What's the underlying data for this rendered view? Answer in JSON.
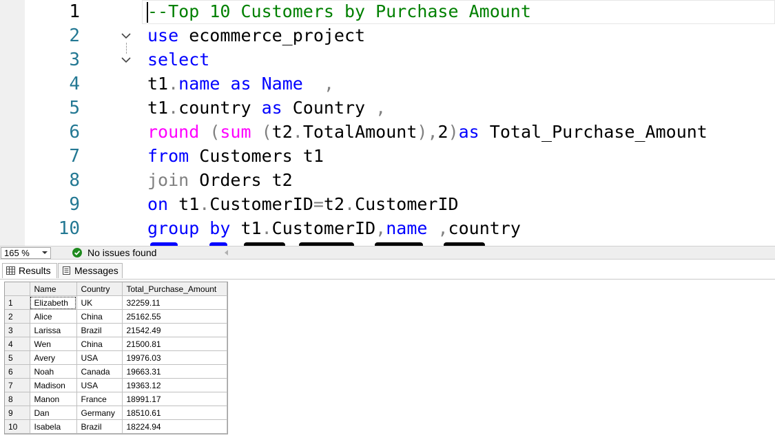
{
  "editor": {
    "active_line": 1,
    "line_numbers": [
      "1",
      "2",
      "3",
      "4",
      "5",
      "6",
      "7",
      "8",
      "9",
      "10"
    ],
    "code_lines": [
      [
        {
          "t": "--Top 10 Customers by Purchase Amount",
          "c": "com"
        }
      ],
      [
        {
          "t": "use",
          "c": "kw"
        },
        {
          "t": " ecommerce_project",
          "c": "id"
        }
      ],
      [
        {
          "t": "select",
          "c": "kw"
        }
      ],
      [
        {
          "t": "t1",
          "c": "id"
        },
        {
          "t": ".",
          "c": "gray"
        },
        {
          "t": "name",
          "c": "kw"
        },
        {
          "t": " ",
          "c": "id"
        },
        {
          "t": "as",
          "c": "kw"
        },
        {
          "t": " ",
          "c": "id"
        },
        {
          "t": "Name",
          "c": "kw"
        },
        {
          "t": "  ,",
          "c": "gray"
        }
      ],
      [
        {
          "t": "t1",
          "c": "id"
        },
        {
          "t": ".",
          "c": "gray"
        },
        {
          "t": "country ",
          "c": "id"
        },
        {
          "t": "as",
          "c": "kw"
        },
        {
          "t": " Country ",
          "c": "id"
        },
        {
          "t": ",",
          "c": "gray"
        }
      ],
      [
        {
          "t": "round",
          "c": "fn"
        },
        {
          "t": " (",
          "c": "gray"
        },
        {
          "t": "sum",
          "c": "fn"
        },
        {
          "t": " (",
          "c": "gray"
        },
        {
          "t": "t2",
          "c": "id"
        },
        {
          "t": ".",
          "c": "gray"
        },
        {
          "t": "TotalAmount",
          "c": "id"
        },
        {
          "t": "),",
          "c": "gray"
        },
        {
          "t": "2",
          "c": "id"
        },
        {
          "t": ")",
          "c": "gray"
        },
        {
          "t": "as",
          "c": "kw"
        },
        {
          "t": " Total_Purchase_Amount",
          "c": "id"
        }
      ],
      [
        {
          "t": "from",
          "c": "kw"
        },
        {
          "t": " Customers t1",
          "c": "id"
        }
      ],
      [
        {
          "t": "join",
          "c": "gray"
        },
        {
          "t": " Orders t2",
          "c": "id"
        }
      ],
      [
        {
          "t": "on",
          "c": "kw"
        },
        {
          "t": " t1",
          "c": "id"
        },
        {
          "t": ".",
          "c": "gray"
        },
        {
          "t": "CustomerID",
          "c": "id"
        },
        {
          "t": "=",
          "c": "gray"
        },
        {
          "t": "t2",
          "c": "id"
        },
        {
          "t": ".",
          "c": "gray"
        },
        {
          "t": "CustomerID",
          "c": "id"
        }
      ],
      [
        {
          "t": "group by",
          "c": "kw"
        },
        {
          "t": " t1",
          "c": "id"
        },
        {
          "t": ".",
          "c": "gray"
        },
        {
          "t": "CustomerID",
          "c": "id"
        },
        {
          "t": ",",
          "c": "gray"
        },
        {
          "t": "name",
          "c": "kw"
        },
        {
          "t": " ,",
          "c": "gray"
        },
        {
          "t": "country",
          "c": "id"
        }
      ]
    ],
    "colors": {
      "com": "#008000",
      "kw": "#0000ff",
      "fn": "#ff00ff",
      "gray": "#808080",
      "id": "#000000",
      "line_number": "#237893"
    }
  },
  "status_bar": {
    "zoom": "165 %",
    "issues_text": "No issues found",
    "issues_icon": "check-circle-icon",
    "issues_color": "#1e8a1e"
  },
  "results": {
    "tabs": [
      {
        "label": "Results",
        "icon": "grid-icon",
        "active": true
      },
      {
        "label": "Messages",
        "icon": "messages-icon",
        "active": false
      }
    ],
    "columns": [
      "Name",
      "Country",
      "Total_Purchase_Amount"
    ],
    "rows": [
      {
        "num": "1",
        "Name": "Elizabeth",
        "Country": "UK",
        "Total_Purchase_Amount": "32259.11"
      },
      {
        "num": "2",
        "Name": "Alice",
        "Country": "China",
        "Total_Purchase_Amount": "25162.55"
      },
      {
        "num": "3",
        "Name": "Larissa",
        "Country": "Brazil",
        "Total_Purchase_Amount": "21542.49"
      },
      {
        "num": "4",
        "Name": "Wen",
        "Country": "China",
        "Total_Purchase_Amount": "21500.81"
      },
      {
        "num": "5",
        "Name": "Avery",
        "Country": "USA",
        "Total_Purchase_Amount": "19976.03"
      },
      {
        "num": "6",
        "Name": "Noah",
        "Country": "Canada",
        "Total_Purchase_Amount": "19663.31"
      },
      {
        "num": "7",
        "Name": "Madison",
        "Country": "USA",
        "Total_Purchase_Amount": "19363.12"
      },
      {
        "num": "8",
        "Name": "Manon",
        "Country": "France",
        "Total_Purchase_Amount": "18991.17"
      },
      {
        "num": "9",
        "Name": "Dan",
        "Country": "Germany",
        "Total_Purchase_Amount": "18510.61"
      },
      {
        "num": "10",
        "Name": "Isabela",
        "Country": "Brazil",
        "Total_Purchase_Amount": "18224.94"
      }
    ]
  }
}
